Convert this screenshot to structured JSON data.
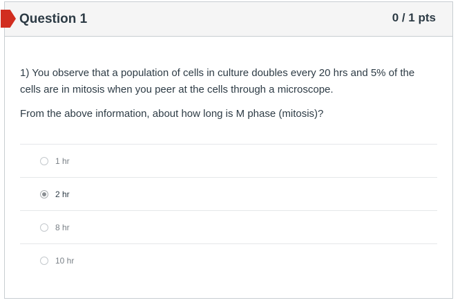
{
  "question": {
    "title": "Question 1",
    "points": "0 / 1 pts",
    "text_line1": "1) You observe that a population of cells in culture doubles every 20 hrs and 5% of the cells are in mitosis when you peer at the cells through a microscope.",
    "text_line2": "From the above information, about how long is M phase (mitosis)?"
  },
  "answers": [
    {
      "label": "1 hr",
      "selected": false
    },
    {
      "label": "2 hr",
      "selected": true
    },
    {
      "label": "8 hr",
      "selected": false
    },
    {
      "label": "10 hr",
      "selected": false
    }
  ],
  "colors": {
    "flag": "#d12d1f",
    "header_bg": "#f5f5f5",
    "text": "#2d3b45",
    "border": "#c7cdd1"
  },
  "icons": {
    "flag": "flag-icon",
    "radio": "radio-button-icon"
  }
}
